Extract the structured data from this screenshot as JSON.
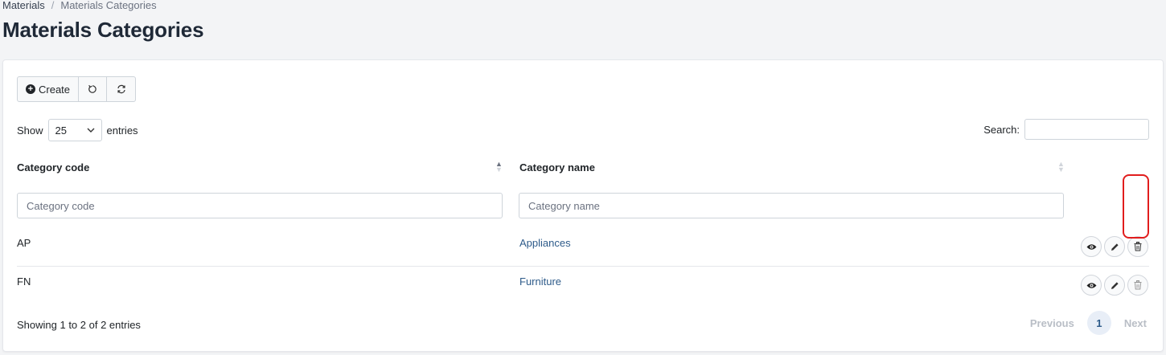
{
  "breadcrumb": {
    "parent": "Materials",
    "separator": "/",
    "current": "Materials Categories"
  },
  "page": {
    "title": "Materials Categories"
  },
  "toolbar": {
    "create_label": "Create"
  },
  "table_controls": {
    "show_label": "Show",
    "page_length": "25",
    "entries_label": "entries",
    "search_label": "Search:"
  },
  "columns": [
    {
      "label": "Category code",
      "filter_placeholder": "Category code"
    },
    {
      "label": "Category name",
      "filter_placeholder": "Category name"
    }
  ],
  "rows": [
    {
      "code": "AP",
      "name": "Appliances"
    },
    {
      "code": "FN",
      "name": "Furniture"
    }
  ],
  "footer": {
    "info": "Showing 1 to 2 of 2 entries",
    "previous": "Previous",
    "current_page": "1",
    "next": "Next"
  },
  "colors": {
    "highlight": "#e11d1d",
    "link": "#2e5b8a"
  },
  "icons": [
    "plus-circle-icon",
    "undo-icon",
    "refresh-icon",
    "chevron-down-icon",
    "sort-icon",
    "eye-icon",
    "pencil-icon",
    "trash-icon"
  ]
}
